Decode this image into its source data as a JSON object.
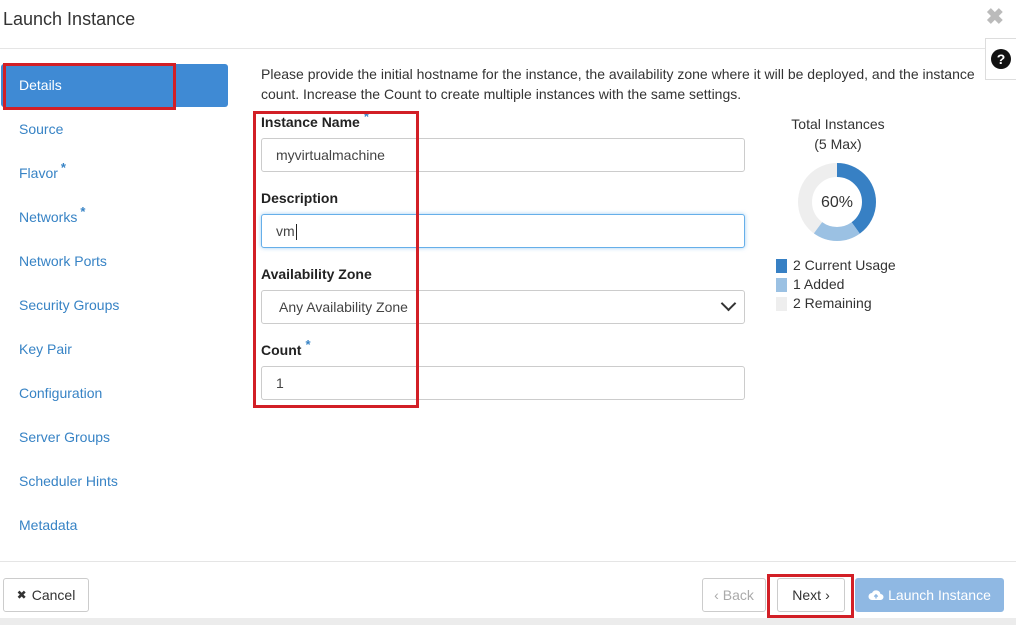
{
  "header": {
    "title": "Launch Instance",
    "close_glyph": "✖",
    "help_glyph": "?"
  },
  "sidebar": {
    "items": [
      {
        "label": "Details",
        "required": false,
        "active": true
      },
      {
        "label": "Source",
        "required": false
      },
      {
        "label": "Flavor",
        "required": true
      },
      {
        "label": "Networks",
        "required": true
      },
      {
        "label": "Network Ports",
        "required": false
      },
      {
        "label": "Security Groups",
        "required": false
      },
      {
        "label": "Key Pair",
        "required": false
      },
      {
        "label": "Configuration",
        "required": false
      },
      {
        "label": "Server Groups",
        "required": false
      },
      {
        "label": "Scheduler Hints",
        "required": false
      },
      {
        "label": "Metadata",
        "required": false
      }
    ],
    "required_mark": "*"
  },
  "form": {
    "intro": "Please provide the initial hostname for the instance, the availability zone where it will be deployed, and the instance count. Increase the Count to create multiple instances with the same settings.",
    "instance_name": {
      "label": "Instance Name",
      "value": "myvirtualmachine"
    },
    "description": {
      "label": "Description",
      "value": "vm"
    },
    "availability_zone": {
      "label": "Availability Zone",
      "value": "Any Availability Zone"
    },
    "count": {
      "label": "Count",
      "value": "1"
    }
  },
  "quota": {
    "title_line1": "Total Instances",
    "title_line2": "(5 Max)",
    "percent_label": "60%",
    "max": 5,
    "current": 2,
    "added": 1,
    "remaining": 2,
    "legend": [
      {
        "label": "2 Current Usage",
        "color": "#3780c4"
      },
      {
        "label": "1 Added",
        "color": "#9bc1e3"
      },
      {
        "label": "2 Remaining",
        "color": "#eeeeee"
      }
    ]
  },
  "footer": {
    "cancel_label": "Cancel",
    "back_label": "Back",
    "next_label": "Next",
    "launch_label": "Launch Instance"
  },
  "colors": {
    "accent": "#3f8ad4",
    "link": "#3783c5",
    "highlight_box": "#d21f26"
  }
}
